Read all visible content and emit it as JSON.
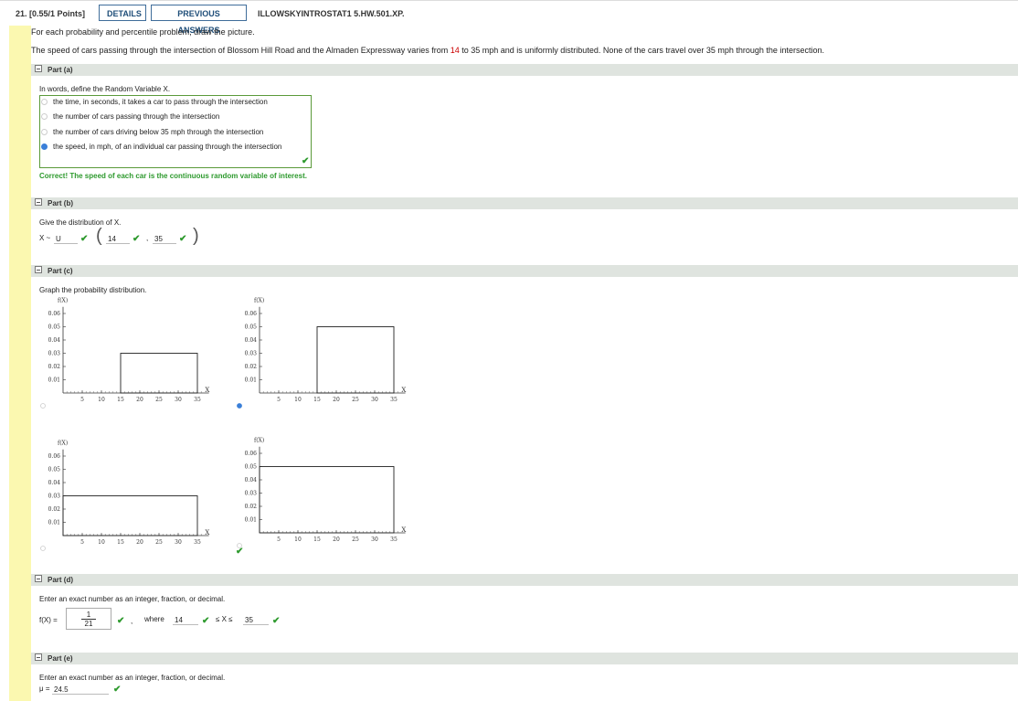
{
  "header": {
    "question_number": "21.",
    "points": "[0.55/1 Points]",
    "details_label": "DETAILS",
    "previous_answers_label": "PREVIOUS ANSWERS",
    "question_code": "ILLOWSKYINTROSTAT1 5.HW.501.XP."
  },
  "intro": "For each probability and percentile problem, draw the picture.",
  "problem": {
    "before": "The speed of cars passing through the intersection of Blossom Hill Road and the Almaden Expressway varies from ",
    "low": "14",
    "after": " to 35 mph and is uniformly distributed. None of the cars travel over 35 mph through the intersection."
  },
  "part_a": {
    "title": "Part (a)",
    "prompt": "In words, define the Random Variable X.",
    "options": [
      "the time, in seconds, it takes a car to pass through the intersection",
      "the number of cars passing through the intersection",
      "the number of cars driving below 35 mph through the intersection",
      "the speed, in mph, of an individual car passing through the intersection"
    ],
    "selected_index": 3,
    "feedback": "Correct! The speed of each car is the continuous random variable of interest."
  },
  "part_b": {
    "title": "Part (b)",
    "prompt": "Give the distribution of X.",
    "x_label": "X ~",
    "dist": "U",
    "param1": "14",
    "comma": ",",
    "param2": "35"
  },
  "part_c": {
    "title": "Part (c)",
    "prompt": "Graph the probability distribution."
  },
  "chart_data": [
    {
      "type": "area",
      "ylabel": "f(X)",
      "xlabel": "X",
      "x_ticks": [
        5,
        10,
        15,
        20,
        25,
        30,
        35
      ],
      "y_ticks": [
        "0.01",
        "0.02",
        "0.03",
        "0.04",
        "0.05",
        "0.06"
      ],
      "ylim": [
        0,
        0.07
      ],
      "rect": {
        "x0": 15,
        "x1": 35,
        "height": 0.03
      },
      "selected": false
    },
    {
      "type": "area",
      "ylabel": "f(X)",
      "xlabel": "X",
      "x_ticks": [
        5,
        10,
        15,
        20,
        25,
        30,
        35
      ],
      "y_ticks": [
        "0.01",
        "0.02",
        "0.03",
        "0.04",
        "0.05",
        "0.06"
      ],
      "ylim": [
        0,
        0.07
      ],
      "rect": {
        "x0": 15,
        "x1": 35,
        "height": 0.05
      },
      "selected": true
    },
    {
      "type": "area",
      "ylabel": "f(X)",
      "xlabel": "X",
      "x_ticks": [
        5,
        10,
        15,
        20,
        25,
        30,
        35
      ],
      "y_ticks": [
        "0.01",
        "0.02",
        "0.03",
        "0.04",
        "0.05",
        "0.06"
      ],
      "ylim": [
        0,
        0.07
      ],
      "rect": {
        "x0": 0,
        "x1": 35,
        "height": 0.03
      },
      "selected": false
    },
    {
      "type": "area",
      "ylabel": "f(X)",
      "xlabel": "X",
      "x_ticks": [
        5,
        10,
        15,
        20,
        25,
        30,
        35
      ],
      "y_ticks": [
        "0.01",
        "0.02",
        "0.03",
        "0.04",
        "0.05",
        "0.06"
      ],
      "ylim": [
        0,
        0.07
      ],
      "rect": {
        "x0": 0,
        "x1": 35,
        "height": 0.05
      },
      "selected": false
    }
  ],
  "part_d": {
    "title": "Part (d)",
    "prompt": "Enter an exact number as an integer, fraction, or decimal.",
    "fx_label": "f(X) =",
    "frac_num": "1",
    "frac_den": "21",
    "where_label": "where",
    "low": "14",
    "ineq": "≤ X ≤",
    "high": "35",
    "comma": ","
  },
  "part_e": {
    "title": "Part (e)",
    "prompt": "Enter an exact number as an integer, fraction, or decimal.",
    "mu_label": "μ =",
    "mu_value": "24.5"
  },
  "icons": {
    "check": "✔",
    "radio": "radio-icon",
    "collapse": "collapse-icon"
  }
}
